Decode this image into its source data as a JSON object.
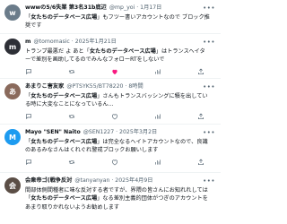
{
  "posts": [
    {
      "name": "wwwの5/6失業 第3名31b底辺",
      "meta": "@mp_yoi · 1月17日",
      "text_pre": "「",
      "text_bold": "女たちのデータベース広場",
      "text_post": "」もフツー書いアカウントなので ブロック推奨です",
      "avatar_color": "#6b7c8a",
      "avatar_glyph": "w",
      "liked": false
    },
    {
      "name": "m",
      "meta": "@tomomasic · 2025年1月21日",
      "text_pre": "トランプ最悪だ よ あと「",
      "text_bold": "女たちのデータベース広場",
      "text_post": "」はトランスヘイターで差別を画助してるのでみんなフォローRTをしないで",
      "avatar_color": "#2d2f36",
      "avatar_glyph": "m",
      "liked": true
    },
    {
      "name": "あまりこ害友家",
      "meta": "@PTSYK55/BT78220 · 8時間",
      "text_pre": "「",
      "text_bold": "女たちのデータベース広場",
      "text_post": "」さんもトランスバッシングに積を出している時に大変なことになっているん…",
      "avatar_color": "#8a6a5c",
      "avatar_glyph": "あ",
      "liked": false
    },
    {
      "name": "Mayo \"SEN\" Naito",
      "meta": "@SEN1227 · 2025年3月2日",
      "text_pre": "「",
      "text_bold": "女たちのデータベース広場",
      "text_post": "」は完全なるヘイトアカウントなので、良識のあるみなさんはくれぐれ警戒ブロックお願いします",
      "avatar_color": "#1d9bf0",
      "avatar_glyph": "M",
      "liked": false
    },
    {
      "name": "会衆帝ゴ(戦争反対",
      "meta": "@tanyanyan · 2025年4月9日",
      "text_pre": "間部体側間種者に味な反対する者ですが、界隈の皆さんにお知れれしては「",
      "text_bold": "女たちのデータベース広場",
      "text_post": "」なる差別主義的団体がつぎのアカウントをあまり取りかれないようお勧めします",
      "avatar_color": "#5b4e46",
      "avatar_glyph": "会",
      "liked": false
    }
  ],
  "action_icons": [
    "reply-icon",
    "retweet-icon",
    "like-icon",
    "views-icon",
    "share-icon"
  ],
  "colors": {
    "like_active": "#f91880",
    "muted": "#536471",
    "text": "#0f1419"
  }
}
